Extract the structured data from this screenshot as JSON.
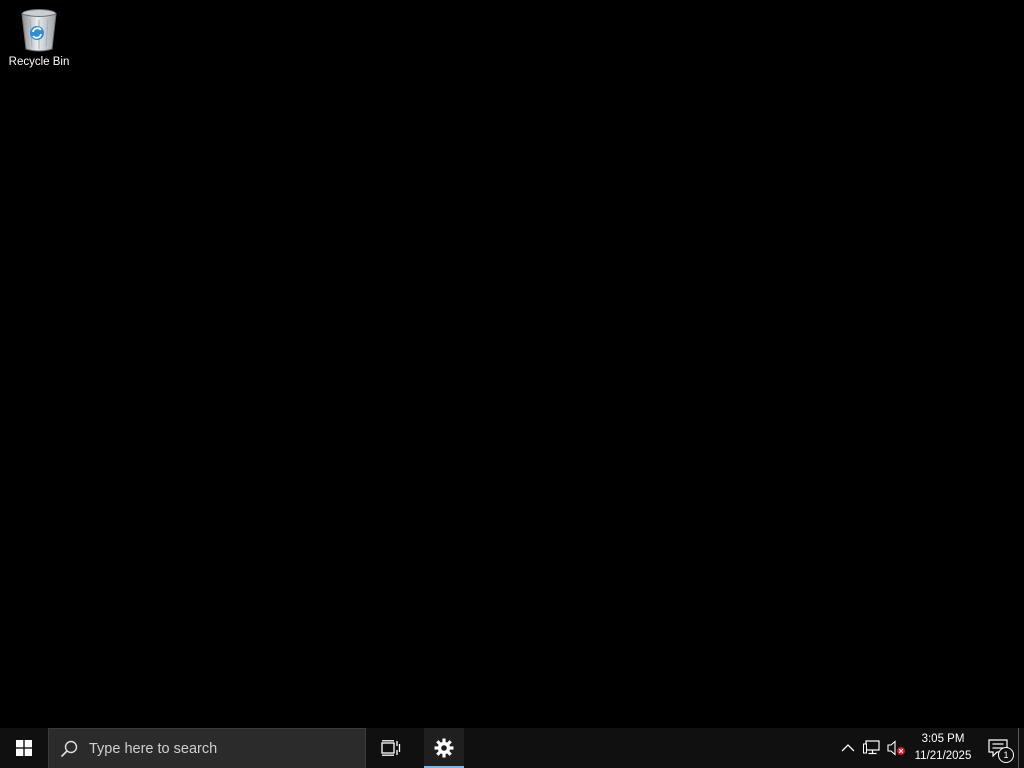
{
  "desktop": {
    "icons": [
      {
        "label": "Recycle Bin",
        "icon": "recycle-bin-icon"
      }
    ]
  },
  "taskbar": {
    "start_icon": "windows-logo-icon",
    "search": {
      "placeholder": "Type here to search",
      "icon": "search-icon"
    },
    "task_view_icon": "task-view-icon",
    "pinned_apps": [
      {
        "name": "Settings",
        "icon": "gear-icon",
        "active": true
      }
    ],
    "tray": {
      "icons": [
        "chevron-up-icon",
        "network-icon",
        "volume-muted-icon"
      ],
      "clock": {
        "time": "3:05 PM",
        "date": "11/21/2025"
      },
      "notifications": {
        "icon": "notification-icon",
        "count": "1"
      }
    },
    "colors": {
      "background": "#101010",
      "search_background": "#2b2b2b",
      "active_indicator": "#76b9ed",
      "desktop": "#000000"
    }
  }
}
